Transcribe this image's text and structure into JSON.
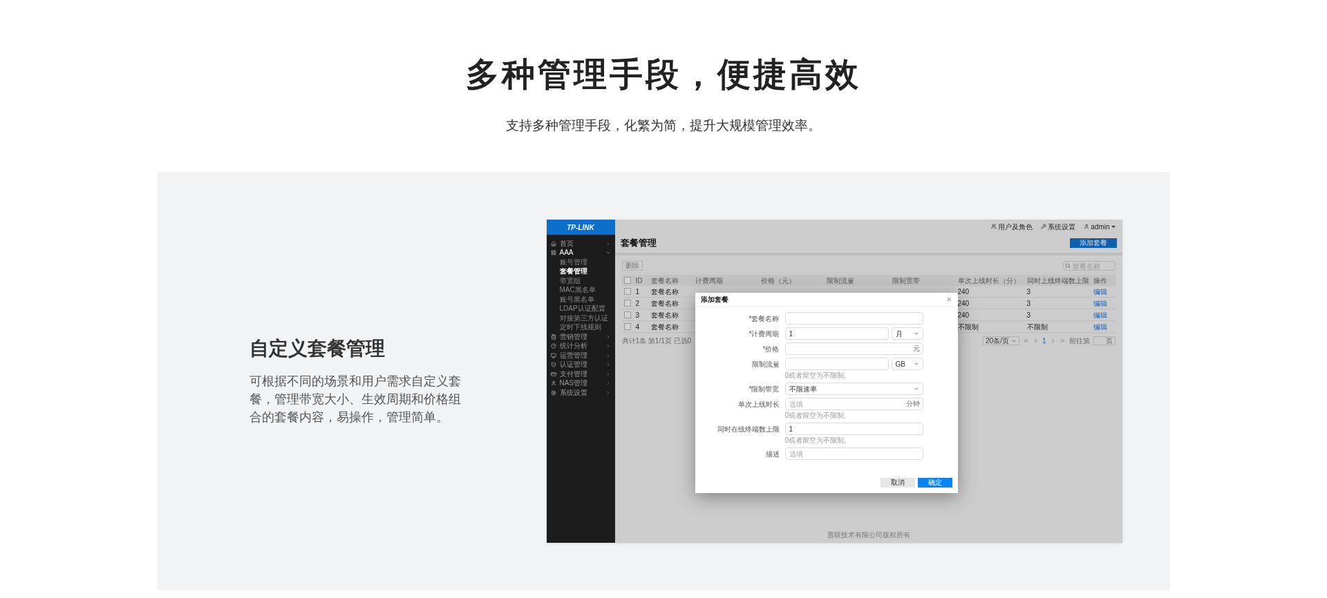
{
  "heading": "多种管理手段，便捷高效",
  "subheading": "支持多种管理手段，化繁为简，提升大规模管理效率。",
  "feature": {
    "title": "自定义套餐管理",
    "text": "可根据不同的场景和用户需求自定义套餐，管理带宽大小、生效周期和价格组合的套餐内容，易操作，管理简单。"
  },
  "app": {
    "logo": "TP-LINK",
    "sidebar": [
      {
        "label": "首页",
        "expanded": false
      },
      {
        "label": "AAA",
        "expanded": true,
        "children": [
          {
            "label": "账号管理",
            "selected": false
          },
          {
            "label": "套餐管理",
            "selected": true
          },
          {
            "label": "带宽组",
            "selected": false
          },
          {
            "label": "MAC黑名单",
            "selected": false
          },
          {
            "label": "账号黑名单",
            "selected": false
          },
          {
            "label": "LDAP认证配置",
            "selected": false
          },
          {
            "label": "对接第三方认证",
            "selected": false
          },
          {
            "label": "定时下线规则",
            "selected": false
          }
        ]
      },
      {
        "label": "营销管理",
        "expanded": false
      },
      {
        "label": "统计分析",
        "expanded": false
      },
      {
        "label": "运营管理",
        "expanded": false
      },
      {
        "label": "认证管理",
        "expanded": false
      },
      {
        "label": "支付管理",
        "expanded": false
      },
      {
        "label": "NAS管理",
        "expanded": false
      },
      {
        "label": "系统设置",
        "expanded": false
      }
    ],
    "top_links": [
      "用户及角色",
      "系统设置",
      "admin"
    ],
    "page_title": "套餐管理",
    "add_button": "添加套餐",
    "delete_button": "删除",
    "search": {
      "placeholder": "套餐名称"
    },
    "table": {
      "header_checked": false,
      "columns": [
        "ID",
        "套餐名称",
        "计费周期",
        "价格（元）",
        "限制流量",
        "限制宽带",
        "单次上线时长（分）",
        "同时上线终端数上限",
        "操作"
      ],
      "rows": [
        {
          "checked": false,
          "id": "1",
          "name": "套餐名称",
          "duration": "240",
          "terminals": "3",
          "action": "编辑"
        },
        {
          "checked": false,
          "id": "2",
          "name": "套餐名称",
          "duration": "240",
          "terminals": "3",
          "action": "编辑"
        },
        {
          "checked": false,
          "id": "3",
          "name": "套餐名称",
          "duration": "240",
          "terminals": "3",
          "action": "编辑"
        },
        {
          "checked": false,
          "id": "4",
          "name": "套餐名称",
          "duration": "不限制",
          "terminals": "不限制",
          "action": "编辑"
        }
      ]
    },
    "pagination": {
      "summary": "共计1条 第1/1页 已选0",
      "page_size": "20条/页",
      "page": "1",
      "goto_label": "前往第",
      "goto_suffix": "页"
    },
    "footer": "普联技术有限公司版权所有",
    "dialog": {
      "title": "添加套餐",
      "fields": [
        {
          "kind": "input",
          "label": "*套餐名称"
        },
        {
          "kind": "input-select",
          "label": "*计费周期",
          "value": "1",
          "select": "月"
        },
        {
          "kind": "input",
          "label": "*价格",
          "suffix": "元"
        },
        {
          "kind": "input-select",
          "label": "限制流量",
          "select": "GB",
          "hint": "0或者留空为不限制。"
        },
        {
          "kind": "select",
          "label": "*限制带宽",
          "select": "不限速率"
        },
        {
          "kind": "input",
          "label": "单次上线时长",
          "placeholder": "选填",
          "suffix": "分钟",
          "hint": "0或者留空为不限制。"
        },
        {
          "kind": "input",
          "label": "同时在线终端数上限",
          "value": "1",
          "hint": "0或者留空为不限制。"
        },
        {
          "kind": "input",
          "label": "描述",
          "placeholder": "选填"
        }
      ],
      "cancel": "取消",
      "confirm": "确定"
    }
  }
}
